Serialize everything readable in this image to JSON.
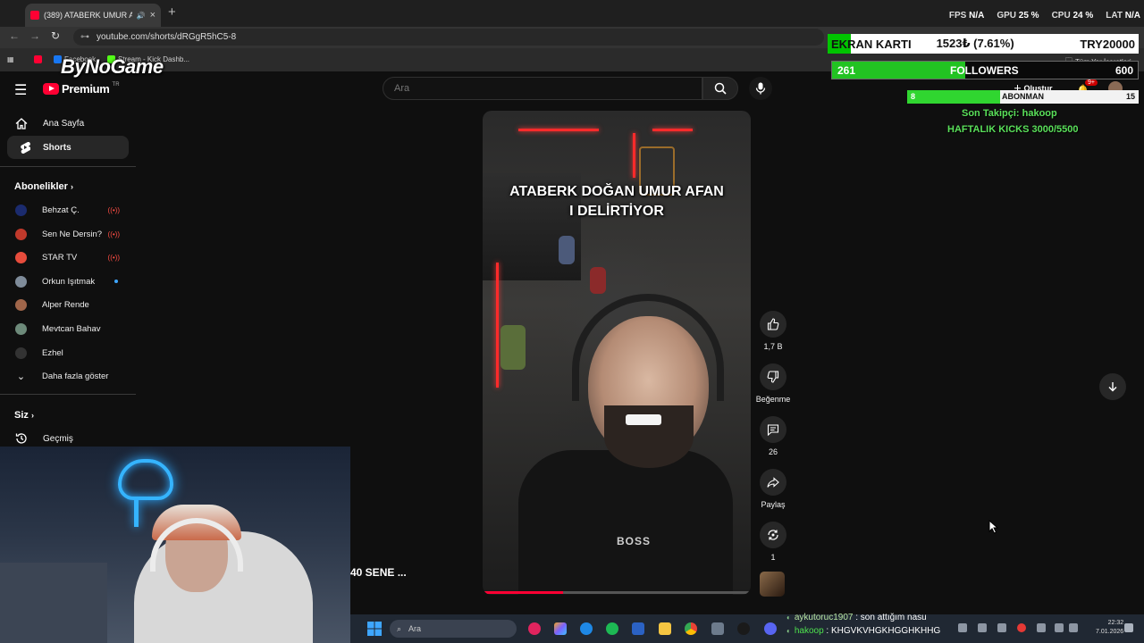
{
  "browser": {
    "tab_title": "(389) ATABERK UMUR AFAN",
    "url": "youtube.com/shorts/dRGgR5hC5-8",
    "bookmarks": [
      "Facebook",
      "Stream - Kick Dashb...",
      "Tüm Yer İşaretleri"
    ]
  },
  "perf": {
    "fps_label": "FPS",
    "fps": "N/A",
    "gpu_label": "GPU",
    "gpu": "25 %",
    "cpu_label": "CPU",
    "cpu": "24 %",
    "lat_label": "LAT",
    "lat": "N/A"
  },
  "brand": {
    "watermark": "ByNoGame"
  },
  "youtube": {
    "logo_text": "Premium",
    "logo_suffix": "TR",
    "search_placeholder": "Ara",
    "nav": [
      {
        "label": "Ana Sayfa"
      },
      {
        "label": "Shorts"
      }
    ],
    "subscriptions_title": "Abonelikler",
    "subscriptions": [
      {
        "name": "Behzat Ç.",
        "status": "live",
        "avatar_color": "#1b2b6e"
      },
      {
        "name": "Sen Ne Dersin?",
        "status": "live",
        "avatar_color": "#c0392b"
      },
      {
        "name": "STAR TV",
        "status": "live",
        "avatar_color": "#e74c3c"
      },
      {
        "name": "Orkun Işıtmak",
        "status": "new",
        "avatar_color": "#7f8c9a"
      },
      {
        "name": "Alper Rende",
        "status": "",
        "avatar_color": "#a0664a"
      },
      {
        "name": "Mevtcan Bahav",
        "status": "",
        "avatar_color": "#6d8a7a"
      },
      {
        "name": "Ezhel",
        "status": "",
        "avatar_color": "#333333"
      }
    ],
    "show_more": "Daha fazla göster",
    "you_title": "Siz",
    "history": "Geçmiş",
    "short": {
      "caption_line1": "ATABERK DOĞAN UMUR AFAN",
      "caption_line2": "I DELİRTİYOR",
      "progress": 0.3,
      "overlay_title": "40 SENE ..."
    },
    "actions": {
      "likes": "1,7 B",
      "dislike_label": "Beğenme",
      "comments": "26",
      "share_label": "Paylaş",
      "remix_count": "1"
    },
    "create_label": "Oluştur",
    "notif_badge": "9+"
  },
  "overlay": {
    "gpu_goal_label": "EKRAN KARTI",
    "gpu_goal_value": "1523₺ (7.61%)",
    "gpu_goal_target": "TRY20000",
    "gpu_goal_fraction": 0.0761,
    "followers_current": "261",
    "followers_label": "FOLLOWERS",
    "followers_target": "600",
    "subs_current": "8",
    "subs_label": "ABONMAN",
    "subs_target": "15",
    "subs_fraction": 0.4,
    "last_follower": "Son Takipçi: hakoop",
    "weekly_kicks": "HAFTALIK KICKS 3000/5500"
  },
  "chat": [
    {
      "user": "aykutoruc1907",
      "message": "son attığım nasu"
    },
    {
      "user": "hakoop",
      "message": "KHGVKVHGKHGGHKHHG"
    }
  ],
  "taskbar": {
    "search": "Ara",
    "time": "22:32",
    "date": "7.01.2026"
  }
}
